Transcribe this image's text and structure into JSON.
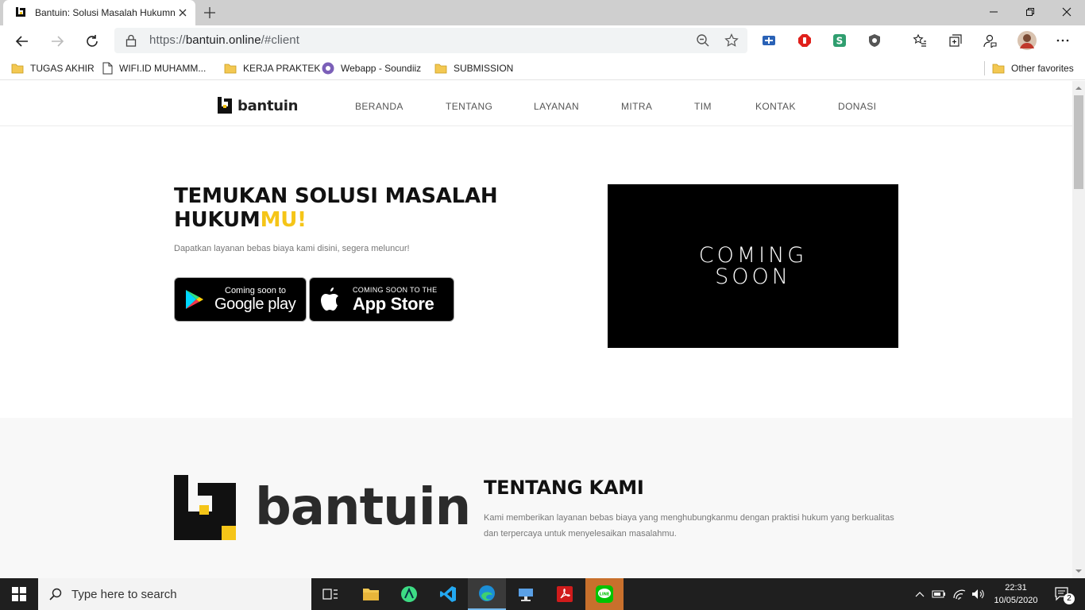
{
  "browser": {
    "tab_title": "Bantuin: Solusi Masalah Hukumnu",
    "url_prefix": "https://",
    "url_host": "bantuin.online",
    "url_path": "/#client"
  },
  "favorites": [
    {
      "label": "TUGAS AKHIR",
      "icon": "folder-icon"
    },
    {
      "label": "WIFI.ID MUHAMM...",
      "icon": "page-icon"
    },
    {
      "label": "KERJA PRAKTEK",
      "icon": "folder-icon"
    },
    {
      "label": "Webapp - Soundiiz",
      "icon": "soundiiz-icon"
    },
    {
      "label": "SUBMISSION",
      "icon": "folder-icon"
    }
  ],
  "other_favorites": "Other favorites",
  "site": {
    "brand": "bantuin",
    "menu": [
      "BERANDA",
      "TENTANG",
      "LAYANAN",
      "MITRA",
      "TIM",
      "KONTAK",
      "DONASI"
    ],
    "hero": {
      "title_line1": "TEMUKAN SOLUSI MASALAH",
      "title_line2_a": "HUKUM",
      "title_line2_b": "MU!",
      "subtitle": "Dapatkan layanan bebas biaya kami disini, segera meluncur!",
      "google_small": "Coming soon to",
      "google_big": "Google play",
      "apple_small": "COMING SOON TO THE",
      "apple_big": "App Store",
      "video_line1": "COMING",
      "video_line2": "SOON"
    },
    "about": {
      "logo_word": "bantuin",
      "title": "TENTANG KAMI",
      "text": "Kami memberikan layanan bebas biaya yang menghubungkanmu dengan praktisi hukum yang berkualitas dan terpercaya untuk menyelesaikan masalahmu."
    }
  },
  "taskbar": {
    "search_placeholder": "Type here to search",
    "time": "22:31",
    "date": "10/05/2020",
    "notification_count": "2"
  },
  "colors": {
    "accent_yellow": "#f5c518",
    "brand_dark": "#111111"
  }
}
